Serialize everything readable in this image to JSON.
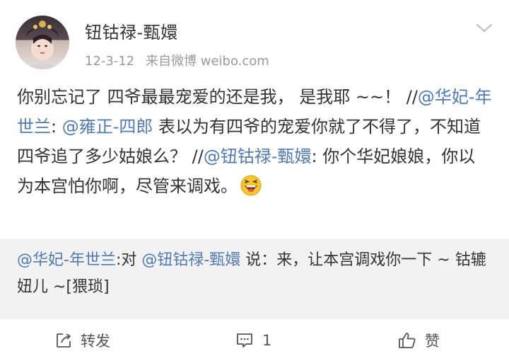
{
  "post": {
    "username": "钮钴禄-甄嬛",
    "date": "12-3-12",
    "source": "来自微博 weibo.com",
    "content": {
      "t1": "你别忘记了 四爷最最宠爱的还是我， 是我耶 ~~！ //",
      "m1": "@华妃-年世兰",
      "t2": ": ",
      "m2": "@雍正-四郎",
      "t3": " 表以为有四爷的宠爱你就了不得了，不知道四爷追了多少姑娘么？ //",
      "m3": "@钮钴禄-甄嬛",
      "t4": ": 你个华妃娘娘，你以为本宫怕你啊，尽管来调戏。"
    },
    "emoji_icon": "laughing-emoji"
  },
  "comment": {
    "m1": "@华妃-年世兰",
    "t1": ":对 ",
    "m2": "@钮钴禄-甄嬛",
    "t2": " 说：来，让本宫调戏你一下 ~ 钴辘妞儿 ~[猥琐]"
  },
  "actions": {
    "repost_label": "转发",
    "comment_count": "1",
    "like_label": "赞"
  },
  "colors": {
    "link": "#4f7ab5",
    "comment_bg": "#f2f2f2",
    "meta": "#9a9a9a"
  }
}
